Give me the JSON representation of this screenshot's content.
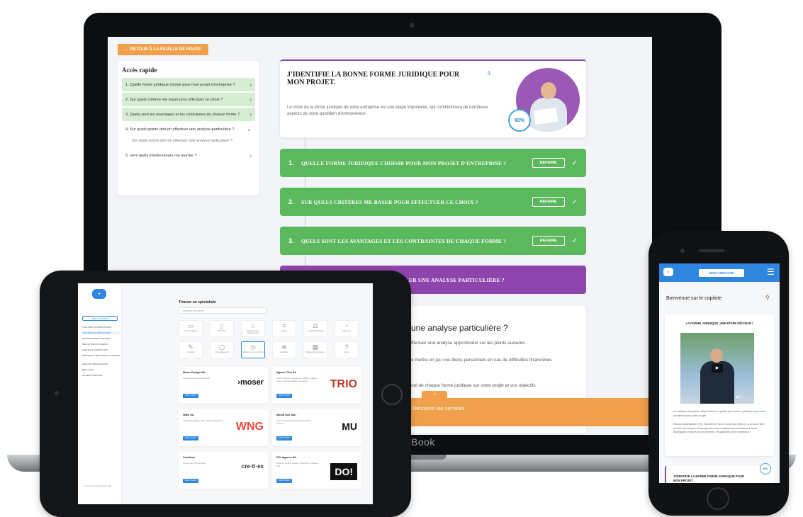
{
  "laptop": {
    "brand": "Book",
    "back_button": "← RETOUR À LA FEUILLE DE ROUTE",
    "quick_access": {
      "title": "Accès rapide",
      "items": [
        "1. Quelle forme juridique choisir pour mon projet d'entreprise ?",
        "2. Sur quels critères me baser pour effectuer ce choix ?",
        "3. Quels sont les avantages et les contraintes de chaque forme ?",
        "4. Sur quels points doit-on effectuer une analyse particulière ?",
        "5. Vers quels interlocuteurs me tourner ?"
      ],
      "sub_item": "Sur quels points doit-on effectuer une analyse particulière ?"
    },
    "intro": {
      "title": "J'IDENTIFIE LA BONNE FORME JURIDIQUE POUR MON PROJET.",
      "text": "Le choix de la forme juridique de votre entreprise est une étape importante, qui conditionnera de nombreux aspects de votre quotidien d'entrepreneur.",
      "progress": "60%"
    },
    "steps": [
      {
        "num": "1.",
        "label": "QUELLE FORME JURIDIQUE CHOISIR POUR MON PROJET D'ENTREPRISE ?",
        "button": "REFAIRE"
      },
      {
        "num": "2.",
        "label": "SUR QUELS CRITÈRES ME BASER POUR EFFECTUER CE CHOIX ?",
        "button": "REFAIRE"
      },
      {
        "num": "3.",
        "label": "QUELS SONT LES AVANTAGES ET LES CONTRAINTES DE CHAQUE FORME ?",
        "button": "REFAIRE"
      },
      {
        "label": "ER UNE ANALYSE PARTICULIÈRE ?"
      }
    ],
    "detail": {
      "title": "une analyse particulière ?",
      "line1": "ffectuer une analyse approfondie sur les points suivants :",
      "line2": "e mettre en jeu vos biens personnels en cas de difficultés financières",
      "line3": "ool de chaque forme juridique sur votre projet et vos objectifs"
    },
    "discover": "Découvrir les services",
    "discover_tab": "^"
  },
  "tablet": {
    "copilot": "MON COPILOTE",
    "nav": [
      "TROUVER UN PRESTATAIRE",
      "TROUVER UN SPÉCIALISTE",
      "MES DEMANDES D'OFFRES",
      "MES AUTRES DOSSIERS",
      "AGENDA & FORMATIONS",
      "DÉPOSER À MES INTERLOCUTEURS",
      "ESPACE PERSONNALISÉ",
      "RÉGLAGES",
      "SE DÉCONNECTER"
    ],
    "footer": "Un outil mis à disposition par",
    "main_title": "Trouver un spécialiste",
    "search_placeholder": "Chercher un expert",
    "categories": [
      "Droit des affaires",
      "Expertise",
      "Banque, Prêt & Financement",
      "Juristes",
      "Comptabilité & Audit",
      "Assurance",
      "Formation",
      "Informatique & IT",
      "Marketing, Design & Web",
      "Immobilier",
      "Ressources Humaines",
      "Autres"
    ],
    "cards": [
      {
        "name": "Moser Design SA",
        "desc": "Prestations de marque identité",
        "button": "DÉCOUVRIR",
        "logo": "›moser"
      },
      {
        "name": "Agence Trio SA",
        "desc": "Communication stratégique, publicité, relations presse, identité visuelle, campagnes",
        "button": "DÉCOUVRIR",
        "logo": "TRIO"
      },
      {
        "name": "WNG SA",
        "desc": "Stratégies digitales, Web, Internet, Marketing",
        "button": "DÉCOUVRIR",
        "logo": "WNG"
      },
      {
        "name": "Minuit Une Sàrl",
        "desc": "Communication stratégique et branding, publicité",
        "button": "DÉCOUVRIR",
        "logo": "MU"
      },
      {
        "name": "Creatives",
        "desc": "Agence de communication",
        "button": "DÉCOUVRIR",
        "logo": "cre·ti·es"
      },
      {
        "name": "DO! Agence SA",
        "desc": "Publicité, identité visuelle, Graphisme, Stratégie Web",
        "button": "DÉCOUVRIR",
        "logo": "DO!"
      }
    ]
  },
  "phone": {
    "copilot": "MON COPILOTE",
    "welcome": "Bienvenue sur le copilote",
    "card_title": "LA FORME JURIDIQUE, UNE ÉTAPE DÉCISIVE !",
    "text1": "Les étapes suivantes dépendront en partie de la forme juridique que vous choisirez pour votre projet.",
    "text2": "Raison individuelle (RI), Société en Nom Commun (SNC) ou encore Sàrl ou SA, les formes d'entreprises sont multiples et ont chacune leurs avantages et leurs inconvénients. Regardons ceci ensemble !",
    "step_title": "J'IDENTIFIE LA BONNE FORME JURIDIQUE POUR MON PROJET.",
    "progress": "60%"
  },
  "colors": {
    "green": "#5cb85c",
    "purple": "#8e44ad",
    "orange": "#f0a04b",
    "blue": "#2e86de"
  }
}
